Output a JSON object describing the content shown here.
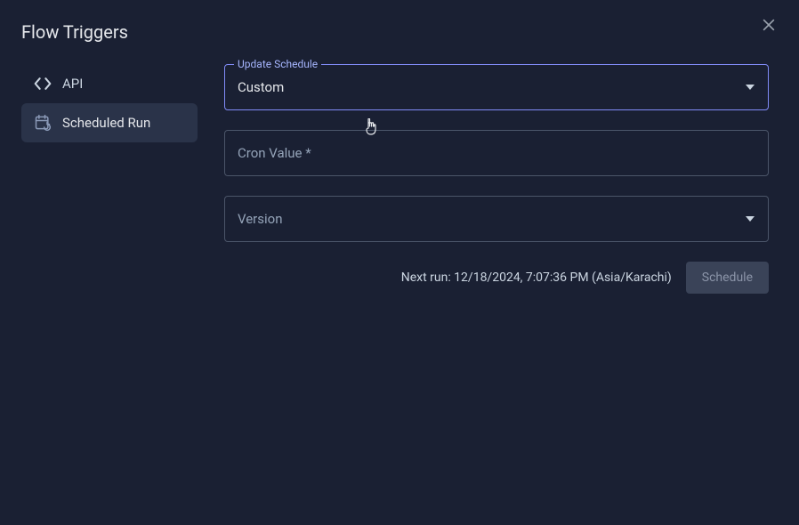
{
  "modal": {
    "title": "Flow Triggers"
  },
  "sidebar": {
    "items": [
      {
        "label": "API"
      },
      {
        "label": "Scheduled Run"
      }
    ]
  },
  "form": {
    "updateSchedule": {
      "label": "Update Schedule",
      "value": "Custom"
    },
    "cronValue": {
      "placeholder": "Cron Value *",
      "value": ""
    },
    "version": {
      "placeholder": "Version",
      "value": ""
    }
  },
  "nextRun": {
    "text": "Next run: 12/18/2024, 7:07:36 PM (Asia/Karachi)"
  },
  "actions": {
    "scheduleLabel": "Schedule"
  }
}
